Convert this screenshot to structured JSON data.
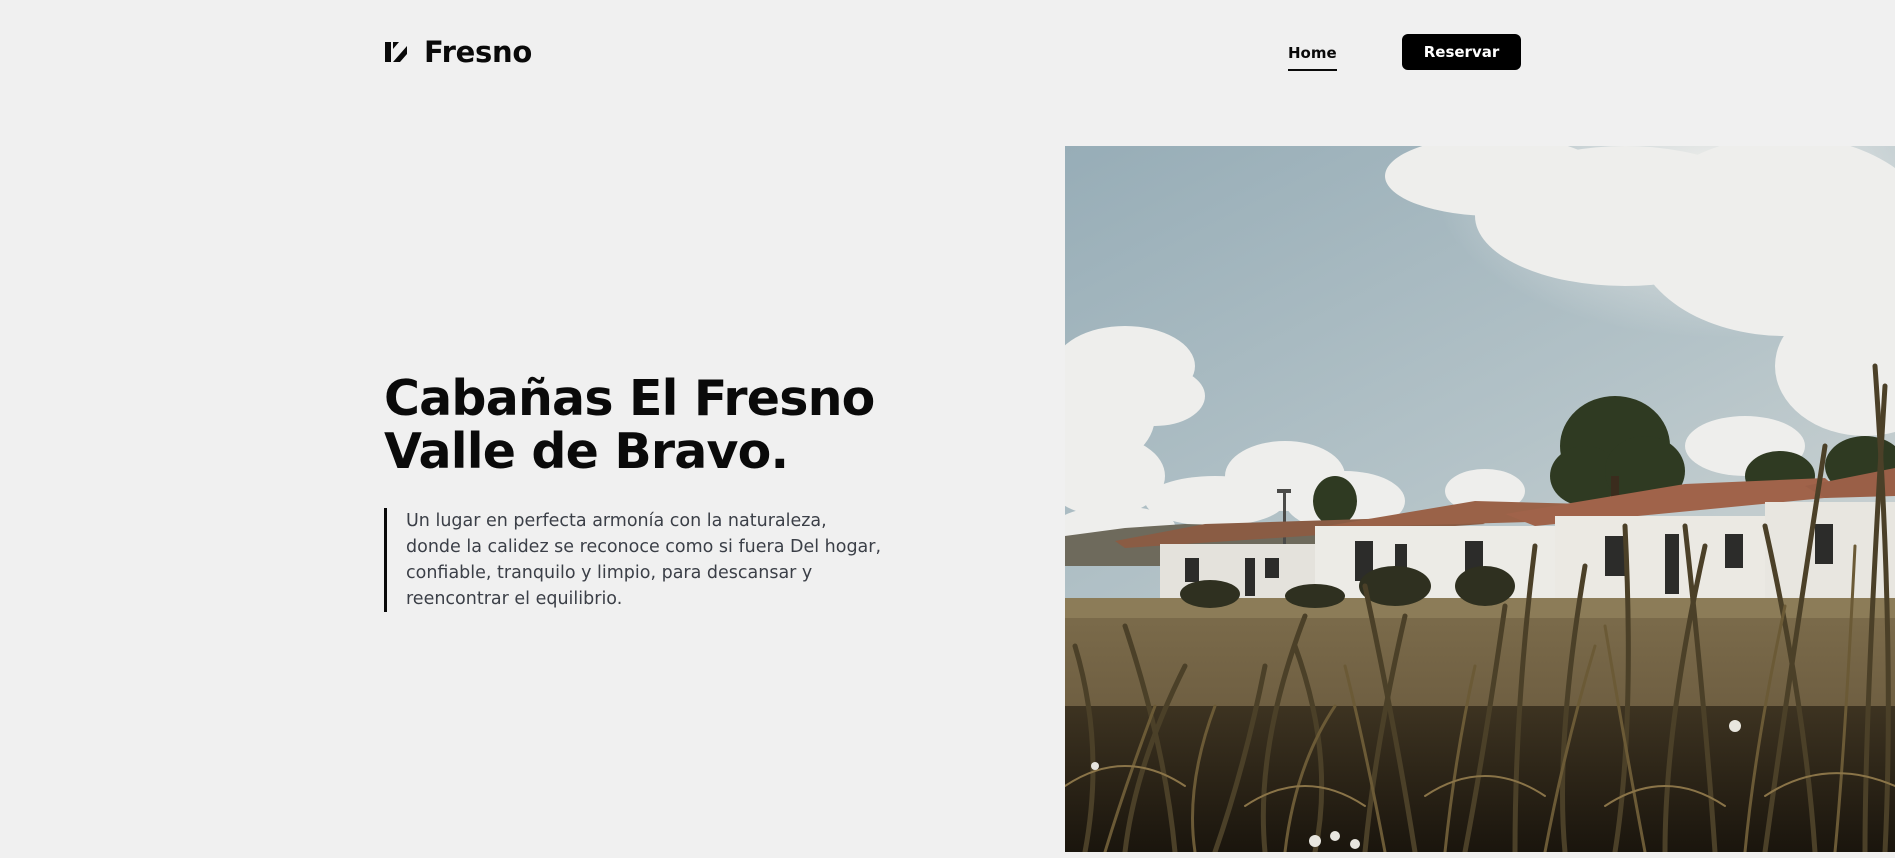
{
  "header": {
    "brand_name": "Fresno",
    "brand_icon": "fresno-logo-mark",
    "nav": {
      "home_label": "Home"
    },
    "reserve_label": "Reservar"
  },
  "hero": {
    "title_line_1": "Cabañas El Fresno",
    "title_line_2": "Valle de Bravo.",
    "description": "Un lugar en perfecta armonía con la naturaleza, donde la calidez se reconoce como si fuera Del hogar, confiable, tranquilo y limpio, para descansar y reencontrar el equilibrio."
  },
  "colors": {
    "background": "#f0f0f0",
    "text": "#0a0a0a",
    "body_text": "#3b3f47",
    "button_bg": "#000000",
    "button_text": "#ffffff"
  }
}
